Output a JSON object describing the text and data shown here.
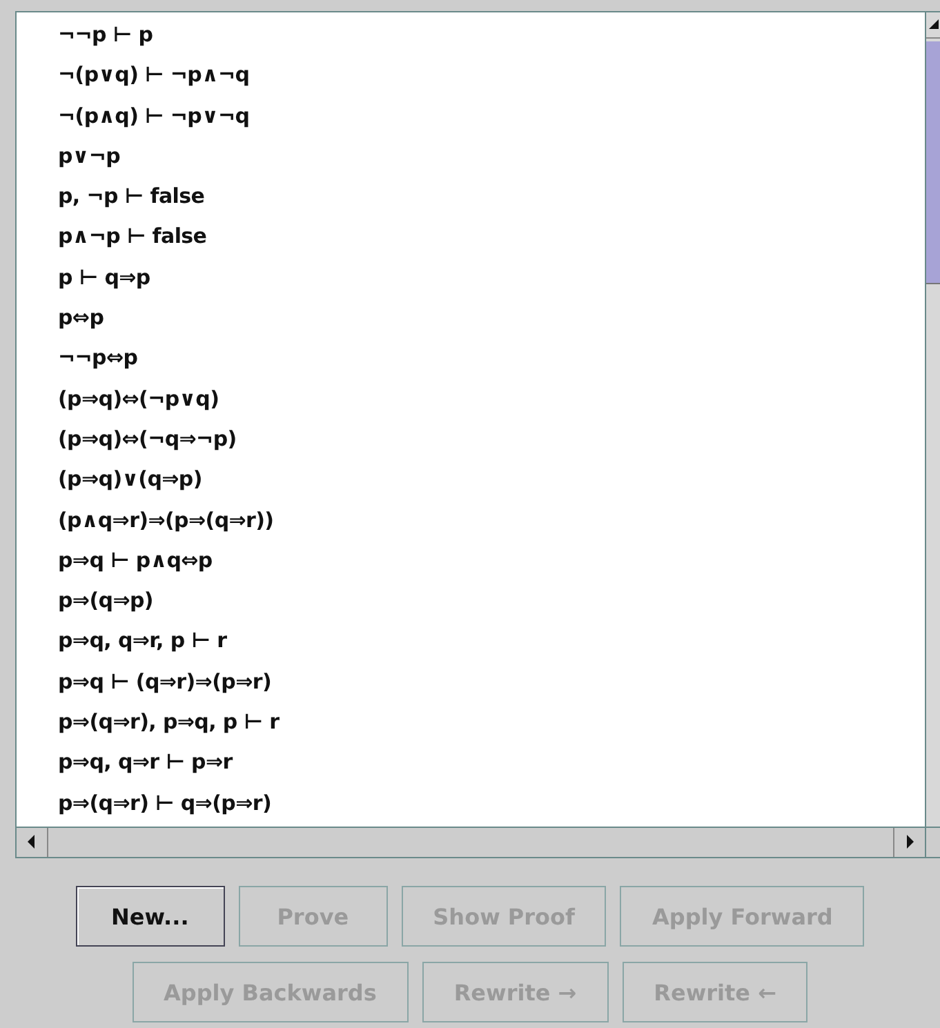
{
  "formulas": [
    "¬¬p ⊢ p",
    "¬(p∨q) ⊢ ¬p∧¬q",
    "¬(p∧q) ⊢ ¬p∨¬q",
    "p∨¬p",
    "p, ¬p ⊢ false",
    "p∧¬p ⊢ false",
    "p ⊢ q⇒p",
    "p⇔p",
    "¬¬p⇔p",
    "(p⇒q)⇔(¬p∨q)",
    "(p⇒q)⇔(¬q⇒¬p)",
    "(p⇒q)∨(q⇒p)",
    "(p∧q⇒r)⇒(p⇒(q⇒r))",
    "p⇒q ⊢ p∧q⇔p",
    "p⇒(q⇒p)",
    "p⇒q, q⇒r, p ⊢ r",
    "p⇒q ⊢ (q⇒r)⇒(p⇒r)",
    "p⇒(q⇒r), p⇒q, p ⊢ r",
    "p⇒q, q⇒r ⊢ p⇒r",
    "p⇒(q⇒r) ⊢ q⇒(p⇒r)"
  ],
  "button_rows": [
    [
      {
        "label": "New...",
        "disabled": false
      },
      {
        "label": "Prove",
        "disabled": true
      },
      {
        "label": "Show Proof",
        "disabled": true
      },
      {
        "label": "Apply Forward",
        "disabled": true
      }
    ],
    [
      {
        "label": "Apply Backwards",
        "disabled": true
      },
      {
        "label": "Rewrite →",
        "disabled": true
      },
      {
        "label": "Rewrite ←",
        "disabled": true
      }
    ]
  ]
}
